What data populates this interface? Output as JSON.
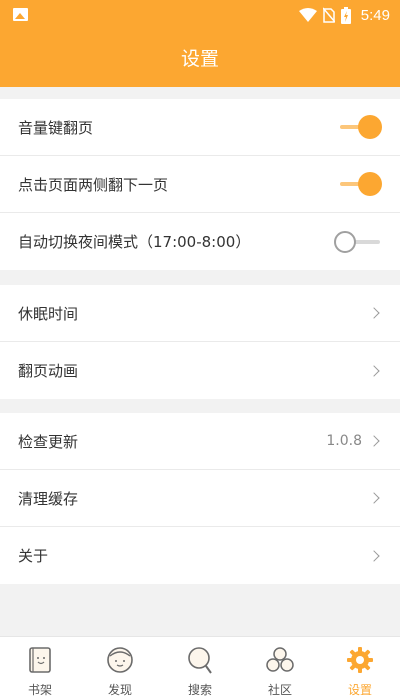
{
  "status_bar": {
    "time": "5:49"
  },
  "header": {
    "title": "设置"
  },
  "groups": [
    {
      "rows": [
        {
          "label": "音量键翻页",
          "toggle": true
        },
        {
          "label": "点击页面两侧翻下一页",
          "toggle": true
        },
        {
          "label": "自动切换夜间模式（17:00-8:00）",
          "toggle": false
        }
      ]
    },
    {
      "rows": [
        {
          "label": "休眠时间"
        },
        {
          "label": "翻页动画"
        }
      ]
    },
    {
      "rows": [
        {
          "label": "检查更新",
          "value": "1.0.8"
        },
        {
          "label": "清理缓存"
        },
        {
          "label": "关于"
        }
      ]
    }
  ],
  "tabs": [
    {
      "label": "书架",
      "icon": "bookshelf-icon"
    },
    {
      "label": "发现",
      "icon": "discover-icon"
    },
    {
      "label": "搜索",
      "icon": "search-icon"
    },
    {
      "label": "社区",
      "icon": "community-icon"
    },
    {
      "label": "设置",
      "icon": "settings-gear-icon",
      "active": true
    }
  ],
  "colors": {
    "accent": "#fca731",
    "background": "#f2f2f2"
  }
}
